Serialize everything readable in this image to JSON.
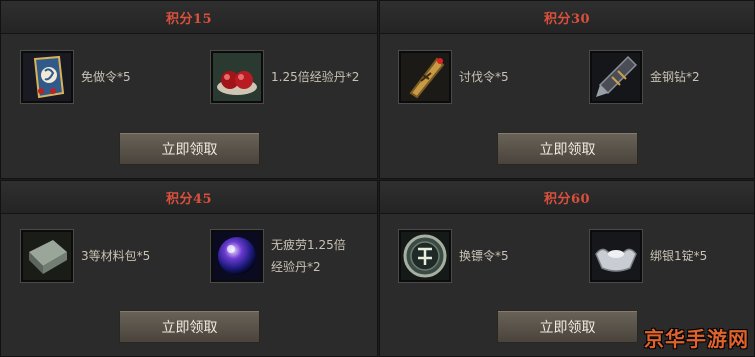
{
  "panels": [
    {
      "title": "积分15",
      "button_label": "立即领取",
      "items": [
        {
          "icon": "exemption-token-icon",
          "label": "免做令*5"
        },
        {
          "icon": "red-pill-icon",
          "label": "1.25倍经验丹*2"
        }
      ]
    },
    {
      "title": "积分30",
      "button_label": "立即领取",
      "items": [
        {
          "icon": "crusade-token-icon",
          "label": "讨伐令*5"
        },
        {
          "icon": "drill-icon",
          "label": "金钢钻*2"
        }
      ]
    },
    {
      "title": "积分45",
      "button_label": "立即领取",
      "items": [
        {
          "icon": "material-pack-icon",
          "label": "3等材料包*5"
        },
        {
          "icon": "crystal-orb-icon",
          "label": "无疲劳1.25倍经验丹*2",
          "label_lines": [
            "无疲劳1.25倍",
            "经验丹*2"
          ]
        }
      ]
    },
    {
      "title": "积分60",
      "button_label": "立即领取",
      "items": [
        {
          "icon": "exchange-token-icon",
          "label": "换镖令*5"
        },
        {
          "icon": "silver-ingot-icon",
          "label": "绑银1锭*5"
        }
      ]
    }
  ],
  "watermark": "京华手游网"
}
